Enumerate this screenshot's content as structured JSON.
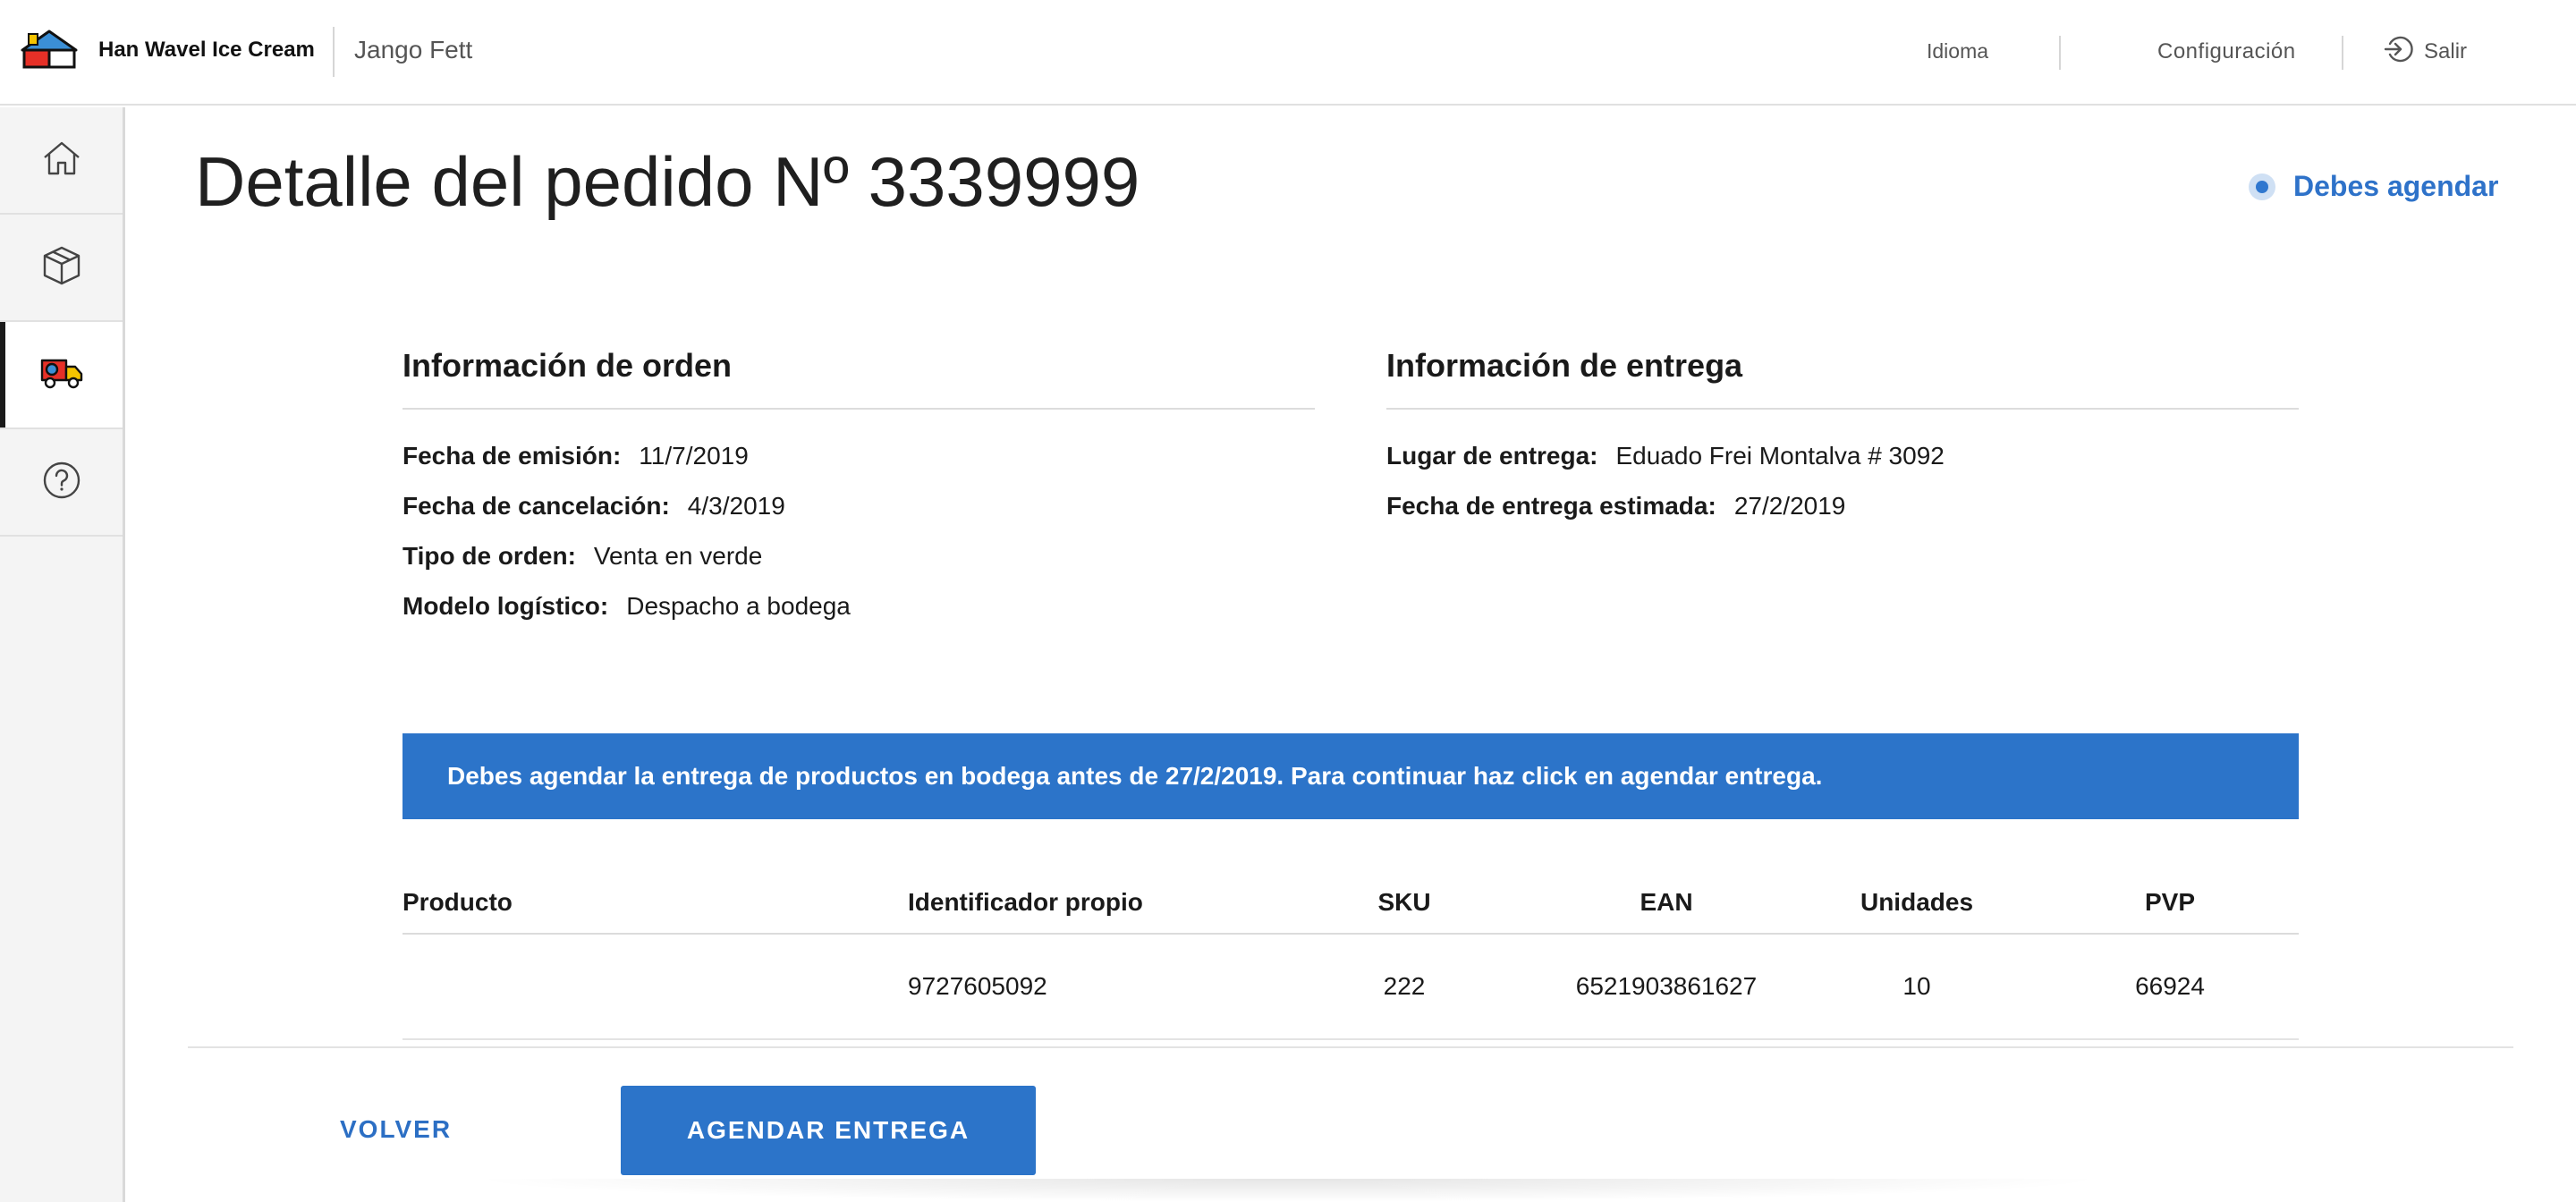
{
  "header": {
    "brand": "Han Wavel Ice Cream",
    "user": "Jango Fett",
    "language": "Idioma",
    "settings": "Configuración",
    "logout": "Salir"
  },
  "sidebar": {
    "items": [
      {
        "name": "home",
        "icon": "home-icon"
      },
      {
        "name": "products",
        "icon": "box-icon"
      },
      {
        "name": "deliveries",
        "icon": "truck-icon",
        "active": true
      },
      {
        "name": "help",
        "icon": "help-icon"
      }
    ]
  },
  "page": {
    "title": "Detalle del pedido Nº 3339999",
    "status": "Debes agendar",
    "status_color": "#2e72c9"
  },
  "order_info": {
    "heading": "Información de orden",
    "rows": [
      {
        "label": "Fecha de emisión:",
        "value": "11/7/2019"
      },
      {
        "label": "Fecha de cancelación:",
        "value": "4/3/2019"
      },
      {
        "label": "Tipo de orden:",
        "value": "Venta en verde"
      },
      {
        "label": "Modelo logístico:",
        "value": "Despacho a bodega"
      }
    ]
  },
  "delivery_info": {
    "heading": "Información de entrega",
    "rows": [
      {
        "label": "Lugar de entrega:",
        "value": "Eduado Frei Montalva # 3092"
      },
      {
        "label": "Fecha de entrega estimada:",
        "value": "27/2/2019"
      }
    ]
  },
  "banner": {
    "text": "Debes agendar la entrega de productos en bodega antes de 27/2/2019. Para continuar haz click en agendar entrega.",
    "color": "#2c74c9"
  },
  "table": {
    "columns": [
      "Producto",
      "Identificador propio",
      "SKU",
      "EAN",
      "Unidades",
      "PVP"
    ],
    "rows": [
      [
        "",
        "9727605092",
        "222",
        "6521903861627",
        "10",
        "66924"
      ]
    ]
  },
  "actions": {
    "back": "VOLVER",
    "schedule": "AGENDAR ENTREGA"
  }
}
